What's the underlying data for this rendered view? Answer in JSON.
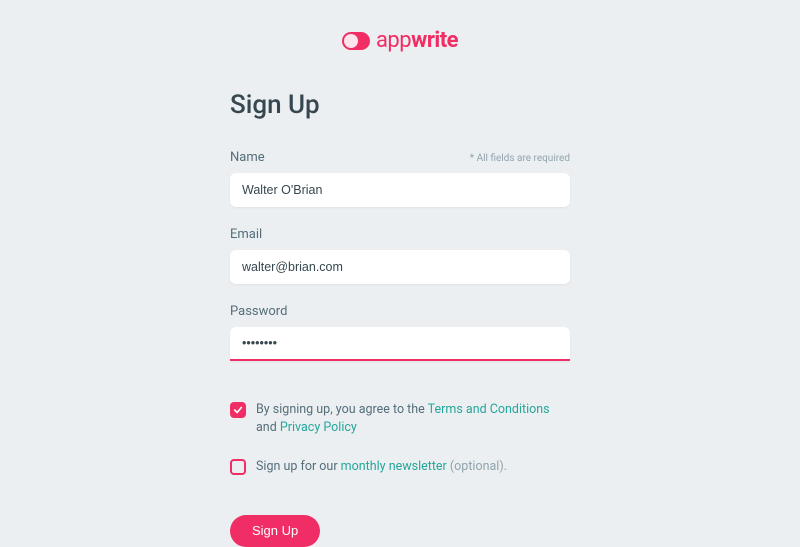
{
  "logo": {
    "part1": "app",
    "part2": "write"
  },
  "page_title": "Sign Up",
  "required_note": "* All fields are required",
  "fields": {
    "name": {
      "label": "Name",
      "value": "Walter O'Brian"
    },
    "email": {
      "label": "Email",
      "value": "walter@brian.com"
    },
    "password": {
      "label": "Password",
      "value": "••••••••"
    }
  },
  "consent": {
    "agree_prefix": "By signing up, you agree to the ",
    "terms_link": "Terms and Conditions",
    "and_text": " and ",
    "privacy_link": "Privacy Policy",
    "agree_checked": true,
    "newsletter_prefix": "Sign up for our ",
    "newsletter_link": "monthly newsletter",
    "newsletter_suffix": " (optional).",
    "newsletter_checked": false
  },
  "submit_label": "Sign Up"
}
